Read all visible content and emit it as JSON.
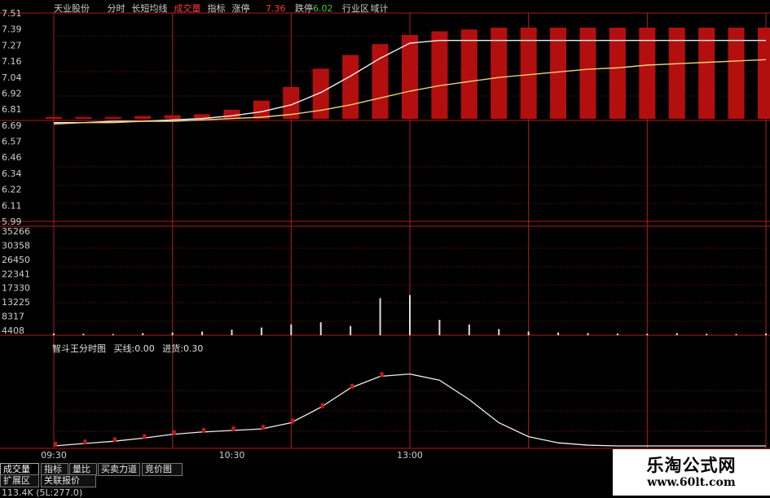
{
  "header": {
    "stock_name": "天业股份",
    "mode_items": [
      {
        "label": "分时",
        "color": "#cfcfcf"
      },
      {
        "label": "长短均线",
        "color": "#cfcfcf"
      },
      {
        "label": "成交量",
        "color": "#ff3b3b"
      },
      {
        "label": "指标",
        "color": "#cfcfcf"
      },
      {
        "label": "涨停",
        "color": "#cfcfcf"
      }
    ],
    "limit_up_value": "7.36",
    "limit_down_label": "跌停",
    "limit_down_value": "6.02",
    "industry_label": "行业区",
    "trailing_text": "域计"
  },
  "price_axis": [
    "7.51",
    "7.39",
    "7.27",
    "7.16",
    "7.04",
    "6.92",
    "6.81",
    "6.69",
    "6.57",
    "6.46",
    "6.34",
    "6.22",
    "6.11",
    "5.99"
  ],
  "volume_axis": [
    "35266",
    "30358",
    "26450",
    "22341",
    "17330",
    "13225",
    "8317",
    "4408"
  ],
  "time_axis": [
    "09:30",
    "10:30",
    "13:00"
  ],
  "indicator": {
    "name": "智斗王分时图",
    "buy_label": "买线:",
    "buy_value": "0.00",
    "sell_label": "进货:",
    "sell_value": "0.30"
  },
  "tabs": [
    {
      "label": "成交量",
      "active": true
    },
    {
      "label": "指标",
      "active": false
    },
    {
      "label": "量比",
      "active": false
    },
    {
      "label": "买卖力道",
      "active": false
    },
    {
      "label": "竞价图",
      "active": false
    },
    {
      "label": "扩展区",
      "active": false
    },
    {
      "label": "关联报价",
      "active": false
    }
  ],
  "status_text": "113.4K (5L:277.0)",
  "watermark": {
    "title": "乐淘公式网",
    "url": "www.60lt.com"
  },
  "chart_data": [
    {
      "type": "line",
      "title": "",
      "x": [
        0,
        10,
        20,
        30,
        40,
        50,
        60,
        70,
        80,
        90,
        100,
        110,
        120,
        130,
        140,
        150,
        160,
        170,
        180,
        190,
        200,
        210,
        220,
        230,
        240
      ],
      "ylim": [
        5.99,
        7.51
      ],
      "series": [
        {
          "values": [
            6.71,
            6.71,
            6.72,
            6.72,
            6.73,
            6.74,
            6.76,
            6.79,
            6.84,
            6.93,
            7.05,
            7.18,
            7.29,
            7.31,
            7.31,
            7.31,
            7.31,
            7.31,
            7.31,
            7.31,
            7.31,
            7.31,
            7.31,
            7.31,
            7.31
          ]
        },
        {
          "values": [
            6.7,
            6.71,
            6.71,
            6.72,
            6.72,
            6.73,
            6.74,
            6.75,
            6.77,
            6.8,
            6.84,
            6.89,
            6.94,
            6.98,
            7.01,
            7.04,
            7.06,
            7.08,
            7.1,
            7.11,
            7.13,
            7.14,
            7.15,
            7.16,
            7.17
          ]
        }
      ],
      "bars": [
        0.02,
        0.02,
        0.02,
        0.03,
        0.04,
        0.05,
        0.1,
        0.2,
        0.35,
        0.55,
        0.7,
        0.82,
        0.92,
        0.96,
        0.98,
        1,
        1,
        1,
        1,
        1,
        1,
        1,
        1,
        1,
        1
      ]
    },
    {
      "type": "bar",
      "title": "",
      "x": [
        0,
        10,
        20,
        30,
        40,
        50,
        60,
        70,
        80,
        90,
        100,
        110,
        120,
        130,
        140,
        150,
        160,
        170,
        180,
        190,
        200,
        210,
        220,
        230,
        240
      ],
      "ylim": [
        0,
        35266
      ],
      "values": [
        600,
        500,
        400,
        700,
        900,
        1200,
        1800,
        2500,
        3500,
        4200,
        3000,
        12000,
        13000,
        5000,
        3500,
        2000,
        1200,
        900,
        700,
        600,
        500,
        700,
        500,
        400,
        600
      ]
    },
    {
      "type": "line",
      "title": "",
      "x": [
        0,
        10,
        20,
        30,
        40,
        50,
        60,
        70,
        80,
        90,
        100,
        110,
        120,
        130,
        140,
        150,
        160,
        170,
        180,
        190,
        200,
        210,
        220,
        230,
        240
      ],
      "values": [
        0.0,
        0.03,
        0.06,
        0.1,
        0.15,
        0.18,
        0.2,
        0.22,
        0.3,
        0.5,
        0.75,
        0.9,
        0.93,
        0.85,
        0.6,
        0.3,
        0.12,
        0.04,
        0.01,
        0.0,
        0.0,
        0.0,
        0.0,
        0.0,
        0.0
      ]
    }
  ]
}
